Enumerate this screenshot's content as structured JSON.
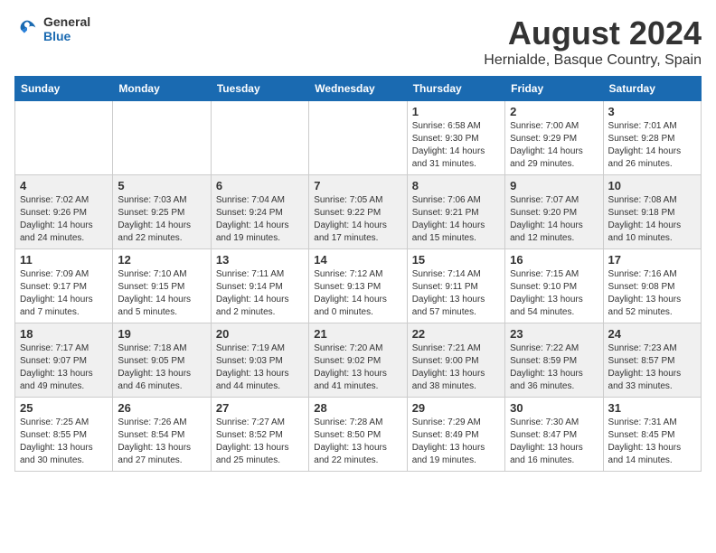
{
  "header": {
    "logo": {
      "general": "General",
      "blue": "Blue"
    },
    "title": "August 2024",
    "location": "Hernialde, Basque Country, Spain"
  },
  "weekdays": [
    "Sunday",
    "Monday",
    "Tuesday",
    "Wednesday",
    "Thursday",
    "Friday",
    "Saturday"
  ],
  "weeks": [
    [
      {
        "day": "",
        "info": ""
      },
      {
        "day": "",
        "info": ""
      },
      {
        "day": "",
        "info": ""
      },
      {
        "day": "",
        "info": ""
      },
      {
        "day": "1",
        "info": "Sunrise: 6:58 AM\nSunset: 9:30 PM\nDaylight: 14 hours\nand 31 minutes."
      },
      {
        "day": "2",
        "info": "Sunrise: 7:00 AM\nSunset: 9:29 PM\nDaylight: 14 hours\nand 29 minutes."
      },
      {
        "day": "3",
        "info": "Sunrise: 7:01 AM\nSunset: 9:28 PM\nDaylight: 14 hours\nand 26 minutes."
      }
    ],
    [
      {
        "day": "4",
        "info": "Sunrise: 7:02 AM\nSunset: 9:26 PM\nDaylight: 14 hours\nand 24 minutes."
      },
      {
        "day": "5",
        "info": "Sunrise: 7:03 AM\nSunset: 9:25 PM\nDaylight: 14 hours\nand 22 minutes."
      },
      {
        "day": "6",
        "info": "Sunrise: 7:04 AM\nSunset: 9:24 PM\nDaylight: 14 hours\nand 19 minutes."
      },
      {
        "day": "7",
        "info": "Sunrise: 7:05 AM\nSunset: 9:22 PM\nDaylight: 14 hours\nand 17 minutes."
      },
      {
        "day": "8",
        "info": "Sunrise: 7:06 AM\nSunset: 9:21 PM\nDaylight: 14 hours\nand 15 minutes."
      },
      {
        "day": "9",
        "info": "Sunrise: 7:07 AM\nSunset: 9:20 PM\nDaylight: 14 hours\nand 12 minutes."
      },
      {
        "day": "10",
        "info": "Sunrise: 7:08 AM\nSunset: 9:18 PM\nDaylight: 14 hours\nand 10 minutes."
      }
    ],
    [
      {
        "day": "11",
        "info": "Sunrise: 7:09 AM\nSunset: 9:17 PM\nDaylight: 14 hours\nand 7 minutes."
      },
      {
        "day": "12",
        "info": "Sunrise: 7:10 AM\nSunset: 9:15 PM\nDaylight: 14 hours\nand 5 minutes."
      },
      {
        "day": "13",
        "info": "Sunrise: 7:11 AM\nSunset: 9:14 PM\nDaylight: 14 hours\nand 2 minutes."
      },
      {
        "day": "14",
        "info": "Sunrise: 7:12 AM\nSunset: 9:13 PM\nDaylight: 14 hours\nand 0 minutes."
      },
      {
        "day": "15",
        "info": "Sunrise: 7:14 AM\nSunset: 9:11 PM\nDaylight: 13 hours\nand 57 minutes."
      },
      {
        "day": "16",
        "info": "Sunrise: 7:15 AM\nSunset: 9:10 PM\nDaylight: 13 hours\nand 54 minutes."
      },
      {
        "day": "17",
        "info": "Sunrise: 7:16 AM\nSunset: 9:08 PM\nDaylight: 13 hours\nand 52 minutes."
      }
    ],
    [
      {
        "day": "18",
        "info": "Sunrise: 7:17 AM\nSunset: 9:07 PM\nDaylight: 13 hours\nand 49 minutes."
      },
      {
        "day": "19",
        "info": "Sunrise: 7:18 AM\nSunset: 9:05 PM\nDaylight: 13 hours\nand 46 minutes."
      },
      {
        "day": "20",
        "info": "Sunrise: 7:19 AM\nSunset: 9:03 PM\nDaylight: 13 hours\nand 44 minutes."
      },
      {
        "day": "21",
        "info": "Sunrise: 7:20 AM\nSunset: 9:02 PM\nDaylight: 13 hours\nand 41 minutes."
      },
      {
        "day": "22",
        "info": "Sunrise: 7:21 AM\nSunset: 9:00 PM\nDaylight: 13 hours\nand 38 minutes."
      },
      {
        "day": "23",
        "info": "Sunrise: 7:22 AM\nSunset: 8:59 PM\nDaylight: 13 hours\nand 36 minutes."
      },
      {
        "day": "24",
        "info": "Sunrise: 7:23 AM\nSunset: 8:57 PM\nDaylight: 13 hours\nand 33 minutes."
      }
    ],
    [
      {
        "day": "25",
        "info": "Sunrise: 7:25 AM\nSunset: 8:55 PM\nDaylight: 13 hours\nand 30 minutes."
      },
      {
        "day": "26",
        "info": "Sunrise: 7:26 AM\nSunset: 8:54 PM\nDaylight: 13 hours\nand 27 minutes."
      },
      {
        "day": "27",
        "info": "Sunrise: 7:27 AM\nSunset: 8:52 PM\nDaylight: 13 hours\nand 25 minutes."
      },
      {
        "day": "28",
        "info": "Sunrise: 7:28 AM\nSunset: 8:50 PM\nDaylight: 13 hours\nand 22 minutes."
      },
      {
        "day": "29",
        "info": "Sunrise: 7:29 AM\nSunset: 8:49 PM\nDaylight: 13 hours\nand 19 minutes."
      },
      {
        "day": "30",
        "info": "Sunrise: 7:30 AM\nSunset: 8:47 PM\nDaylight: 13 hours\nand 16 minutes."
      },
      {
        "day": "31",
        "info": "Sunrise: 7:31 AM\nSunset: 8:45 PM\nDaylight: 13 hours\nand 14 minutes."
      }
    ]
  ]
}
